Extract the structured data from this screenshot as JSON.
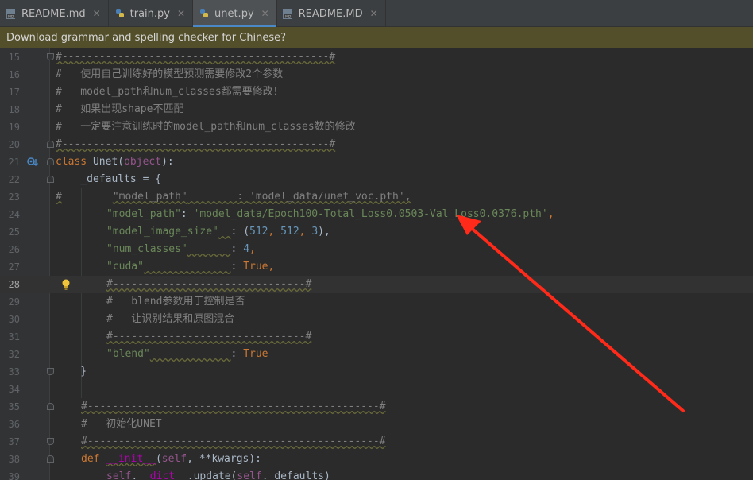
{
  "tabs": [
    {
      "label": "README.md",
      "icon": "markdown-file-icon",
      "active": false
    },
    {
      "label": "train.py",
      "icon": "python-file-icon",
      "active": false
    },
    {
      "label": "unet.py",
      "icon": "python-file-icon",
      "active": true
    },
    {
      "label": "README.MD",
      "icon": "markdown-file-icon",
      "active": false
    }
  ],
  "banner": {
    "text": "Download grammar and spelling checker for Chinese?"
  },
  "current_line": 28,
  "lines": [
    {
      "n": "15"
    },
    {
      "n": "16"
    },
    {
      "n": "17"
    },
    {
      "n": "18"
    },
    {
      "n": "19"
    },
    {
      "n": "20"
    },
    {
      "n": "21"
    },
    {
      "n": "22"
    },
    {
      "n": "23"
    },
    {
      "n": "24"
    },
    {
      "n": "25"
    },
    {
      "n": "26"
    },
    {
      "n": "27"
    },
    {
      "n": "28"
    },
    {
      "n": "29"
    },
    {
      "n": "30"
    },
    {
      "n": "31"
    },
    {
      "n": "32"
    },
    {
      "n": "33"
    },
    {
      "n": "34"
    },
    {
      "n": "35"
    },
    {
      "n": "36"
    },
    {
      "n": "37"
    },
    {
      "n": "38"
    },
    {
      "n": "39"
    }
  ],
  "code": {
    "l15": "#-------------------------------------------#",
    "l16": "#   使用自己训练好的模型预测需要修改2个参数",
    "l17": "#   model_path和num_classes都需要修改！",
    "l18": "#   如果出现shape不匹配",
    "l19": "#   一定要注意训练时的model_path和num_classes数的修改",
    "l20": "#-------------------------------------------#",
    "l21_kw": "class",
    "l21_name": " Unet(",
    "l21_base": "object",
    "l21_end": "):",
    "l22": "    _defaults = {",
    "l23_hash": "#",
    "l23_key": "\"model_path\"",
    "l23_pad": "        ",
    "l23_colon": ": ",
    "l23_val": "'model_data/unet_voc.pth'",
    "l23_comma": ",",
    "l24_key": "\"model_path\"",
    "l24_colon": ": ",
    "l24_val": "'model_data/Epoch100-Total_Loss0.0503-Val_Loss0.0376.pth'",
    "l24_comma": ",",
    "l25_key": "\"model_image_size\"",
    "l25_pad": "  ",
    "l25_colon": ": (",
    "l25_n1": "512",
    "l25_sep1": ", ",
    "l25_n2": "512",
    "l25_sep2": ", ",
    "l25_n3": "3",
    "l25_end": "),",
    "l26_key": "\"num_classes\"",
    "l26_pad": "       ",
    "l26_colon": ": ",
    "l26_val": "4",
    "l26_comma": ",",
    "l27_key": "\"cuda\"",
    "l27_pad": "              ",
    "l27_colon": ": ",
    "l27_val": "True",
    "l27_comma": ",",
    "l28": "#-------------------------------#",
    "l29": "#   blend参数用于控制是否",
    "l30": "#   让识别结果和原图混合",
    "l31": "#-------------------------------#",
    "l32_key": "\"blend\"",
    "l32_pad": "             ",
    "l32_colon": ": ",
    "l32_val": "True",
    "l33": "    }",
    "l35": "#-----------------------------------------------#",
    "l36": "#   初始化UNET",
    "l37": "#-----------------------------------------------#",
    "l38_kw": "def",
    "l38_fn": "__init__",
    "l38_open": "(",
    "l38_self": "self",
    "l38_rest": ", **kwargs):",
    "l39_self": "self",
    "l39_dot": ".",
    "l39_dict": "__dict__",
    "l39_upd": ".update(",
    "l39_self2": "self",
    "l39_end": "._defaults)"
  },
  "colors": {
    "annotation_arrow": "#ff2a1a",
    "keyword": "#cc7832",
    "string": "#6a8759",
    "number": "#6897bb",
    "comment": "#808080"
  }
}
